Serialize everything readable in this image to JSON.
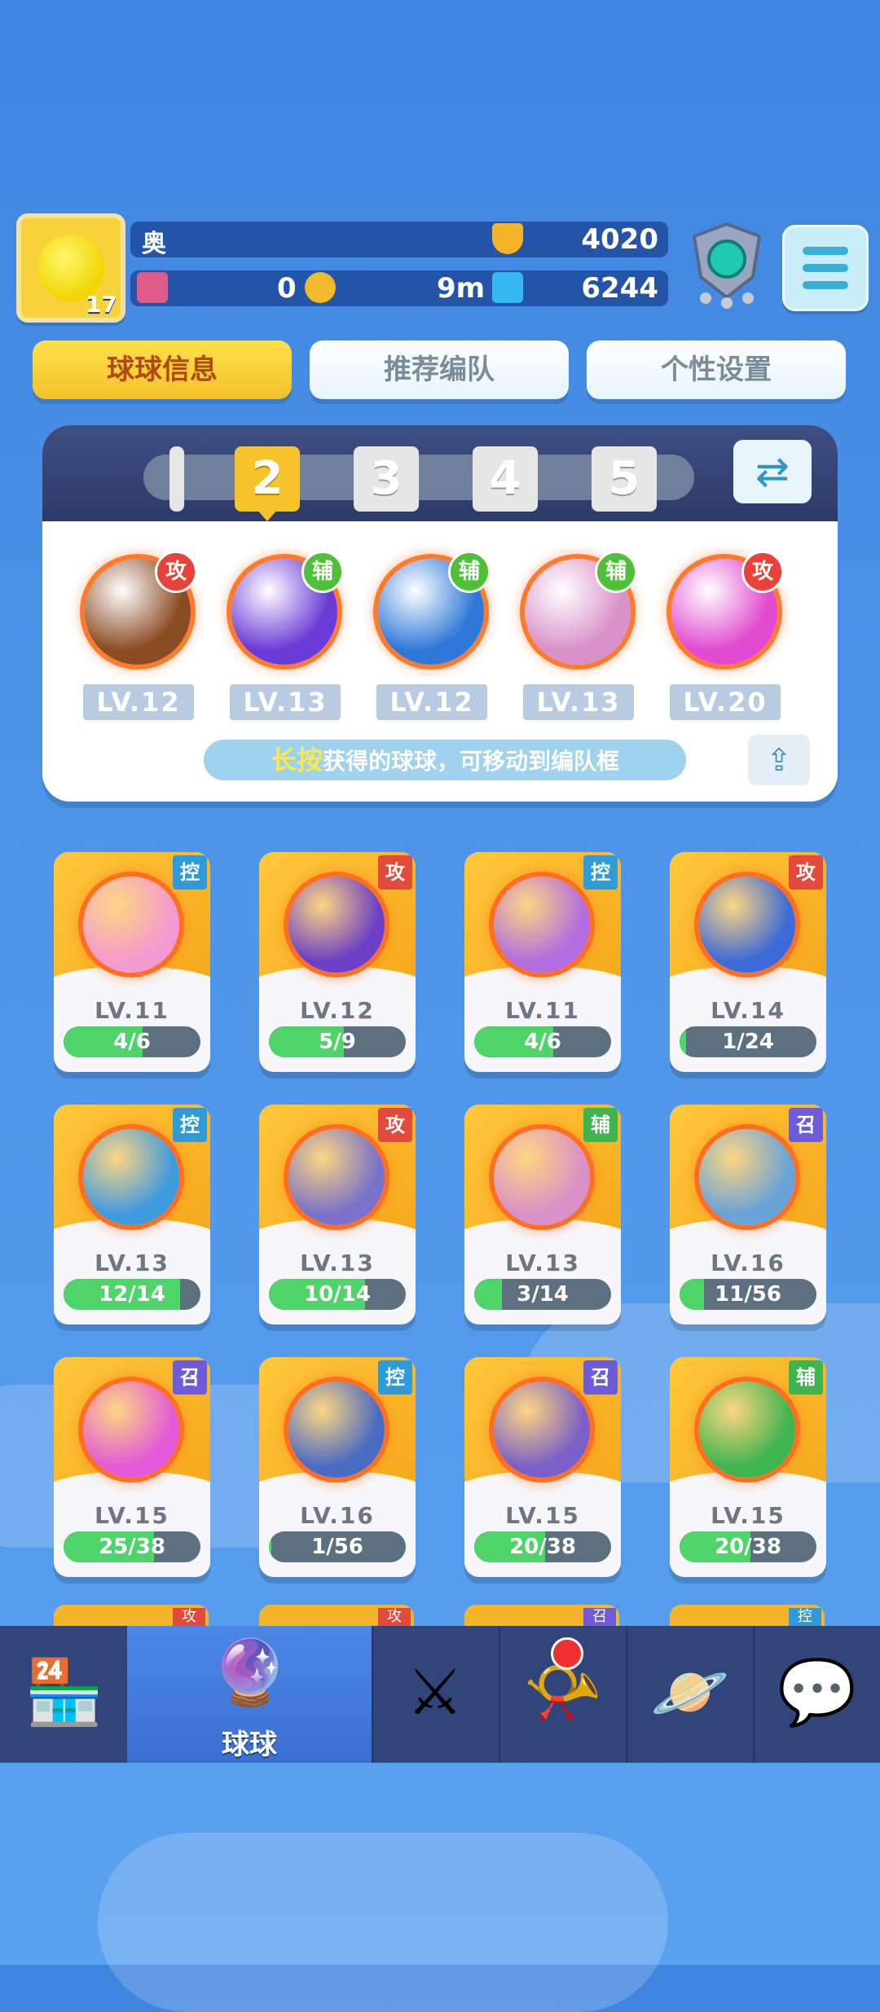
{
  "player": {
    "name": "奥",
    "level": "17",
    "trophies": "4020",
    "tickets": "0",
    "coin_timer": "9m",
    "gems": "6244"
  },
  "tabs": [
    {
      "label": "球球信息",
      "active": true
    },
    {
      "label": "推荐编队",
      "active": false
    },
    {
      "label": "个性设置",
      "active": false
    }
  ],
  "team": {
    "slots": [
      "2",
      "3",
      "4",
      "5"
    ],
    "active_slot": "2",
    "balls": [
      {
        "level": "LV.12",
        "role": "攻",
        "icon": "infinity-ball-icon",
        "color": "#8a4a22"
      },
      {
        "level": "LV.13",
        "role": "辅",
        "icon": "lightning-ball-icon",
        "color": "#6a3bd6"
      },
      {
        "level": "LV.12",
        "role": "辅",
        "icon": "hexagon-ball-icon",
        "color": "#2f78d8"
      },
      {
        "level": "LV.13",
        "role": "辅",
        "icon": "clone-ball-icon",
        "color": "#d991c8"
      },
      {
        "level": "LV.20",
        "role": "攻",
        "icon": "shield-ball-icon",
        "color": "#e04bd0"
      }
    ],
    "hint_highlight": "长按",
    "hint_text": "获得的球球，可移动到编队框"
  },
  "cards": [
    {
      "level": "LV.11",
      "progress": "4/6",
      "fill": 0.58,
      "tag": "控",
      "icon": "heart-ball-icon",
      "color": "#f59ad0"
    },
    {
      "level": "LV.12",
      "progress": "5/9",
      "fill": 0.55,
      "tag": "攻",
      "icon": "sword-ball-icon",
      "color": "#6d3fc7"
    },
    {
      "level": "LV.11",
      "progress": "4/6",
      "fill": 0.58,
      "tag": "控",
      "icon": "butterfly-ball-icon",
      "color": "#b36ce0"
    },
    {
      "level": "LV.14",
      "progress": "1/24",
      "fill": 0.05,
      "tag": "攻",
      "icon": "vortex-ball-icon",
      "color": "#3d6ad8"
    },
    {
      "level": "LV.13",
      "progress": "12/14",
      "fill": 0.85,
      "tag": "控",
      "icon": "wind-ball-icon",
      "color": "#3f9be0"
    },
    {
      "level": "LV.13",
      "progress": "10/14",
      "fill": 0.7,
      "tag": "攻",
      "icon": "block-ball-icon",
      "color": "#7a72c9"
    },
    {
      "level": "LV.13",
      "progress": "3/14",
      "fill": 0.2,
      "tag": "辅",
      "icon": "clone-ball-icon",
      "color": "#d991c8"
    },
    {
      "level": "LV.16",
      "progress": "11/56",
      "fill": 0.18,
      "tag": "召",
      "icon": "spiral-ball-icon",
      "color": "#6aa3d8"
    },
    {
      "level": "LV.15",
      "progress": "25/38",
      "fill": 0.66,
      "tag": "召",
      "icon": "tree-ball-icon",
      "color": "#e35ad8"
    },
    {
      "level": "LV.16",
      "progress": "1/56",
      "fill": 0.02,
      "tag": "控",
      "icon": "clock-ball-icon",
      "color": "#4a6bc4"
    },
    {
      "level": "LV.15",
      "progress": "20/38",
      "fill": 0.52,
      "tag": "召",
      "icon": "ghost-ball-icon",
      "color": "#7b5fc8"
    },
    {
      "level": "LV.15",
      "progress": "20/38",
      "fill": 0.52,
      "tag": "辅",
      "icon": "arrow-ball-icon",
      "color": "#3fb550"
    }
  ],
  "peek_tags": [
    "攻",
    "攻",
    "召",
    "控"
  ],
  "nav": [
    {
      "label": "",
      "icon": "shop-icon",
      "active": false
    },
    {
      "label": "球球",
      "icon": "ball-jar-icon",
      "active": true
    },
    {
      "label": "",
      "icon": "crossed-swords-icon",
      "active": false
    },
    {
      "label": "",
      "icon": "whistle-icon",
      "active": false,
      "badge": true
    },
    {
      "label": "",
      "icon": "planet-icon",
      "active": false
    },
    {
      "label": "",
      "icon": "chat-heart-icon",
      "active": false
    }
  ]
}
